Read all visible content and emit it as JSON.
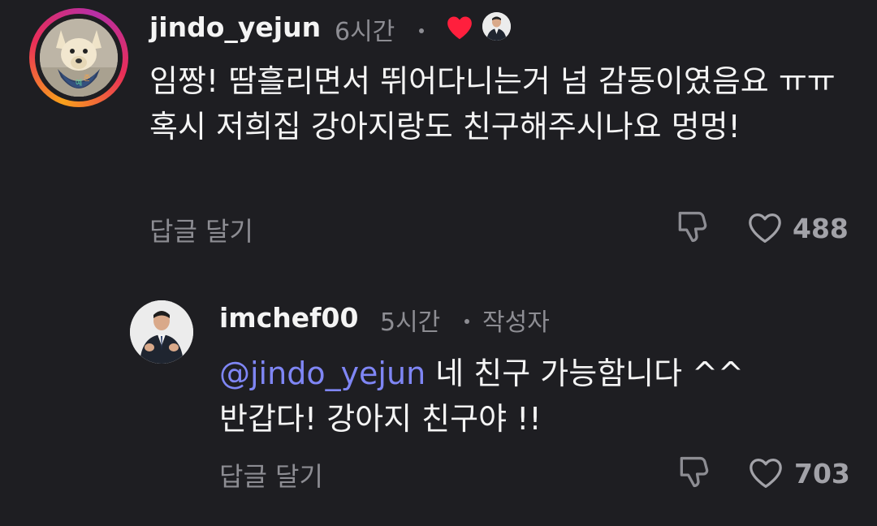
{
  "comments": [
    {
      "username": "jindo_yejun",
      "time": "6시간",
      "body": "임짱! 땀흘리면서 뛰어다니는거 넘 감동이였음요 ㅠㅠ 혹시 저희집 강아지랑도 친구해주시나요 멍멍!",
      "reply_label": "답글 달기",
      "like_count": "488",
      "liked_by_author": true,
      "avatar_icon": "dog-photo-avatar",
      "avatar_ring_colors": [
        "#f9a11b",
        "#e92e58",
        "#b62fa6"
      ]
    },
    {
      "username": "imchef00",
      "time": "5시간",
      "author_tag": "작성자",
      "mention": "@jindo_yejun",
      "body": " 네 친구 가능함니다 ^^ 반갑다! 강아지 친구야 !!",
      "reply_label": "답글 달기",
      "like_count": "703",
      "avatar_icon": "chef-photo-avatar"
    }
  ],
  "colors": {
    "background": "#1e1e22",
    "text": "#f4f4f4",
    "muted": "#8d8d93",
    "mention": "#7f86f5",
    "heart": "#ff1f3d"
  }
}
